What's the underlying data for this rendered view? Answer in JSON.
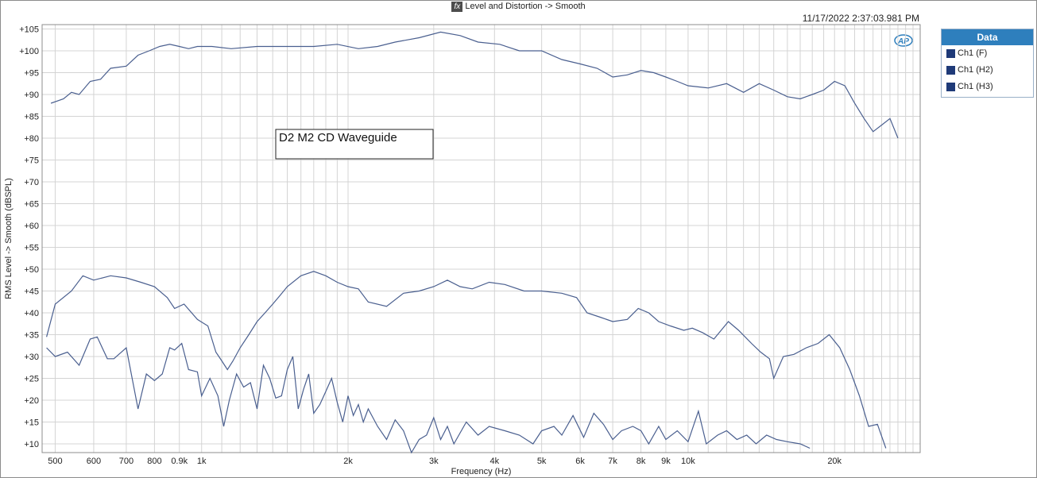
{
  "window": {
    "title": "Level and Distortion -> Smooth",
    "title_icon": "fx-icon",
    "timestamp": "11/17/2022 2:37:03.981 PM",
    "logo": "AP"
  },
  "legend": {
    "header": "Data",
    "items": [
      "Ch1 (F)",
      "Ch1 (H2)",
      "Ch1 (H3)"
    ]
  },
  "colors": {
    "trace": "#4a5f8f",
    "grid": "#d4d4d4",
    "legend_header": "#2e7fbd",
    "swatch": "#1f3a78"
  },
  "chart_data": {
    "type": "line",
    "x_scale": "log",
    "xlabel": "Frequency (Hz)",
    "ylabel": "RMS Level -> Smooth (dBSPL)",
    "xlim": [
      470,
      30000
    ],
    "ylim": [
      8,
      106
    ],
    "annotation": "D2 M2 CD Waveguide",
    "grid": true,
    "legend_position": "right",
    "x_ticks": [
      {
        "v": 500,
        "label": "500"
      },
      {
        "v": 600,
        "label": "600"
      },
      {
        "v": 700,
        "label": "700"
      },
      {
        "v": 800,
        "label": "800"
      },
      {
        "v": 900,
        "label": "0.9k"
      },
      {
        "v": 1000,
        "label": "1k"
      },
      {
        "v": 2000,
        "label": "2k"
      },
      {
        "v": 3000,
        "label": "3k"
      },
      {
        "v": 4000,
        "label": "4k"
      },
      {
        "v": 5000,
        "label": "5k"
      },
      {
        "v": 6000,
        "label": "6k"
      },
      {
        "v": 7000,
        "label": "7k"
      },
      {
        "v": 8000,
        "label": "8k"
      },
      {
        "v": 9000,
        "label": "9k"
      },
      {
        "v": 10000,
        "label": "10k"
      },
      {
        "v": 20000,
        "label": "20k"
      }
    ],
    "x_minor": [
      1100,
      1200,
      1300,
      1400,
      1500,
      1600,
      1700,
      1800,
      1900,
      11000,
      12000,
      13000,
      14000,
      15000,
      16000,
      17000,
      18000,
      19000,
      21000,
      22000,
      23000,
      24000,
      25000,
      26000,
      27000,
      28000,
      29000
    ],
    "y_ticks": [
      {
        "v": 10,
        "label": "+10"
      },
      {
        "v": 15,
        "label": "+15"
      },
      {
        "v": 20,
        "label": "+20"
      },
      {
        "v": 25,
        "label": "+25"
      },
      {
        "v": 30,
        "label": "+30"
      },
      {
        "v": 35,
        "label": "+35"
      },
      {
        "v": 40,
        "label": "+40"
      },
      {
        "v": 45,
        "label": "+45"
      },
      {
        "v": 50,
        "label": "+50"
      },
      {
        "v": 55,
        "label": "+55"
      },
      {
        "v": 60,
        "label": "+60"
      },
      {
        "v": 65,
        "label": "+65"
      },
      {
        "v": 70,
        "label": "+70"
      },
      {
        "v": 75,
        "label": "+75"
      },
      {
        "v": 80,
        "label": "+80"
      },
      {
        "v": 85,
        "label": "+85"
      },
      {
        "v": 90,
        "label": "+90"
      },
      {
        "v": 95,
        "label": "+95"
      },
      {
        "v": 100,
        "label": "+100"
      },
      {
        "v": 105,
        "label": "+105"
      }
    ],
    "series": [
      {
        "name": "Ch1 (F)",
        "points": [
          [
            490,
            88
          ],
          [
            520,
            89
          ],
          [
            540,
            90.5
          ],
          [
            560,
            90
          ],
          [
            590,
            93
          ],
          [
            620,
            93.5
          ],
          [
            650,
            96
          ],
          [
            700,
            96.5
          ],
          [
            740,
            99
          ],
          [
            780,
            100
          ],
          [
            820,
            101
          ],
          [
            860,
            101.5
          ],
          [
            900,
            101
          ],
          [
            940,
            100.5
          ],
          [
            980,
            101
          ],
          [
            1050,
            101
          ],
          [
            1150,
            100.5
          ],
          [
            1300,
            101
          ],
          [
            1500,
            101
          ],
          [
            1700,
            101
          ],
          [
            1900,
            101.5
          ],
          [
            2100,
            100.5
          ],
          [
            2300,
            101
          ],
          [
            2500,
            102
          ],
          [
            2800,
            103
          ],
          [
            3100,
            104.3
          ],
          [
            3400,
            103.5
          ],
          [
            3700,
            102
          ],
          [
            4100,
            101.5
          ],
          [
            4500,
            100
          ],
          [
            5000,
            100
          ],
          [
            5500,
            98
          ],
          [
            6000,
            97
          ],
          [
            6500,
            96
          ],
          [
            7000,
            94
          ],
          [
            7500,
            94.5
          ],
          [
            8000,
            95.5
          ],
          [
            8500,
            95
          ],
          [
            9000,
            94
          ],
          [
            9500,
            93
          ],
          [
            10000,
            92
          ],
          [
            11000,
            91.5
          ],
          [
            12000,
            92.5
          ],
          [
            13000,
            90.5
          ],
          [
            14000,
            92.5
          ],
          [
            15000,
            91
          ],
          [
            16000,
            89.5
          ],
          [
            17000,
            89
          ],
          [
            18000,
            90
          ],
          [
            19000,
            91
          ],
          [
            20000,
            93
          ],
          [
            21000,
            92
          ],
          [
            22000,
            88
          ],
          [
            23000,
            84.5
          ],
          [
            24000,
            81.5
          ],
          [
            25000,
            83
          ],
          [
            26000,
            84.5
          ],
          [
            27000,
            80
          ]
        ]
      },
      {
        "name": "Ch1 (H2)",
        "points": [
          [
            480,
            34.5
          ],
          [
            500,
            42
          ],
          [
            540,
            45
          ],
          [
            570,
            48.5
          ],
          [
            600,
            47.5
          ],
          [
            650,
            48.5
          ],
          [
            700,
            48
          ],
          [
            750,
            47
          ],
          [
            800,
            46
          ],
          [
            850,
            43.5
          ],
          [
            880,
            41
          ],
          [
            920,
            42
          ],
          [
            980,
            38.5
          ],
          [
            1030,
            37
          ],
          [
            1070,
            31
          ],
          [
            1100,
            29
          ],
          [
            1130,
            27
          ],
          [
            1160,
            29
          ],
          [
            1200,
            32
          ],
          [
            1250,
            35
          ],
          [
            1300,
            38
          ],
          [
            1350,
            40
          ],
          [
            1400,
            42
          ],
          [
            1450,
            44
          ],
          [
            1500,
            46
          ],
          [
            1600,
            48.5
          ],
          [
            1700,
            49.5
          ],
          [
            1800,
            48.5
          ],
          [
            1900,
            47
          ],
          [
            2000,
            46
          ],
          [
            2100,
            45.5
          ],
          [
            2200,
            42.5
          ],
          [
            2400,
            41.5
          ],
          [
            2600,
            44.5
          ],
          [
            2800,
            45
          ],
          [
            3000,
            46
          ],
          [
            3200,
            47.5
          ],
          [
            3400,
            46
          ],
          [
            3600,
            45.5
          ],
          [
            3900,
            47
          ],
          [
            4200,
            46.5
          ],
          [
            4600,
            45
          ],
          [
            5000,
            45
          ],
          [
            5500,
            44.5
          ],
          [
            5900,
            43.5
          ],
          [
            6200,
            40
          ],
          [
            6600,
            39
          ],
          [
            7000,
            38
          ],
          [
            7500,
            38.5
          ],
          [
            7900,
            41
          ],
          [
            8300,
            40
          ],
          [
            8700,
            38
          ],
          [
            9200,
            37
          ],
          [
            9800,
            36
          ],
          [
            10200,
            36.5
          ],
          [
            10700,
            35.5
          ],
          [
            11300,
            34
          ],
          [
            12100,
            38
          ],
          [
            12700,
            36
          ],
          [
            13500,
            33
          ],
          [
            14100,
            31
          ],
          [
            14700,
            29.5
          ],
          [
            15000,
            25
          ],
          [
            15700,
            30
          ],
          [
            16500,
            30.5
          ],
          [
            17500,
            32
          ],
          [
            18500,
            33
          ],
          [
            19500,
            35
          ],
          [
            20500,
            32
          ],
          [
            21500,
            27
          ],
          [
            22500,
            21
          ],
          [
            23500,
            14
          ],
          [
            24500,
            14.5
          ],
          [
            25500,
            9
          ]
        ]
      },
      {
        "name": "Ch1 (H3)",
        "points": [
          [
            480,
            32
          ],
          [
            500,
            30
          ],
          [
            530,
            31
          ],
          [
            560,
            28
          ],
          [
            590,
            34
          ],
          [
            610,
            34.5
          ],
          [
            640,
            29.5
          ],
          [
            660,
            29.5
          ],
          [
            700,
            32
          ],
          [
            740,
            18
          ],
          [
            770,
            26
          ],
          [
            800,
            24.5
          ],
          [
            830,
            26
          ],
          [
            860,
            32
          ],
          [
            880,
            31.5
          ],
          [
            910,
            33
          ],
          [
            940,
            27
          ],
          [
            980,
            26.5
          ],
          [
            1000,
            21
          ],
          [
            1040,
            25
          ],
          [
            1080,
            21
          ],
          [
            1110,
            14
          ],
          [
            1140,
            20
          ],
          [
            1180,
            26
          ],
          [
            1220,
            23
          ],
          [
            1260,
            24
          ],
          [
            1300,
            18
          ],
          [
            1340,
            28
          ],
          [
            1380,
            25
          ],
          [
            1420,
            20.5
          ],
          [
            1460,
            21
          ],
          [
            1500,
            27
          ],
          [
            1540,
            30
          ],
          [
            1580,
            18
          ],
          [
            1620,
            22.5
          ],
          [
            1660,
            26
          ],
          [
            1700,
            17
          ],
          [
            1750,
            19
          ],
          [
            1800,
            22
          ],
          [
            1850,
            25
          ],
          [
            1900,
            19.5
          ],
          [
            1950,
            15
          ],
          [
            2000,
            21
          ],
          [
            2050,
            16.5
          ],
          [
            2100,
            19
          ],
          [
            2150,
            15
          ],
          [
            2200,
            18
          ],
          [
            2300,
            14
          ],
          [
            2400,
            11
          ],
          [
            2500,
            15.5
          ],
          [
            2600,
            13
          ],
          [
            2700,
            8
          ],
          [
            2800,
            11
          ],
          [
            2900,
            12
          ],
          [
            3000,
            16
          ],
          [
            3100,
            11
          ],
          [
            3200,
            14
          ],
          [
            3300,
            10
          ],
          [
            3500,
            15
          ],
          [
            3700,
            12
          ],
          [
            3900,
            14
          ],
          [
            4200,
            13
          ],
          [
            4500,
            12
          ],
          [
            4800,
            10
          ],
          [
            5000,
            13
          ],
          [
            5300,
            14
          ],
          [
            5500,
            12
          ],
          [
            5800,
            16.5
          ],
          [
            6100,
            11.5
          ],
          [
            6400,
            17
          ],
          [
            6700,
            14.5
          ],
          [
            7000,
            11
          ],
          [
            7300,
            13
          ],
          [
            7700,
            14
          ],
          [
            8000,
            13
          ],
          [
            8300,
            10
          ],
          [
            8700,
            14
          ],
          [
            9000,
            11
          ],
          [
            9500,
            13
          ],
          [
            10000,
            10.5
          ],
          [
            10500,
            17.5
          ],
          [
            10900,
            10
          ],
          [
            11500,
            12
          ],
          [
            12000,
            13
          ],
          [
            12600,
            11
          ],
          [
            13200,
            12
          ],
          [
            13800,
            10
          ],
          [
            14500,
            12
          ],
          [
            15200,
            11
          ],
          [
            16000,
            10.5
          ],
          [
            17000,
            10
          ],
          [
            17800,
            9
          ]
        ]
      }
    ]
  }
}
